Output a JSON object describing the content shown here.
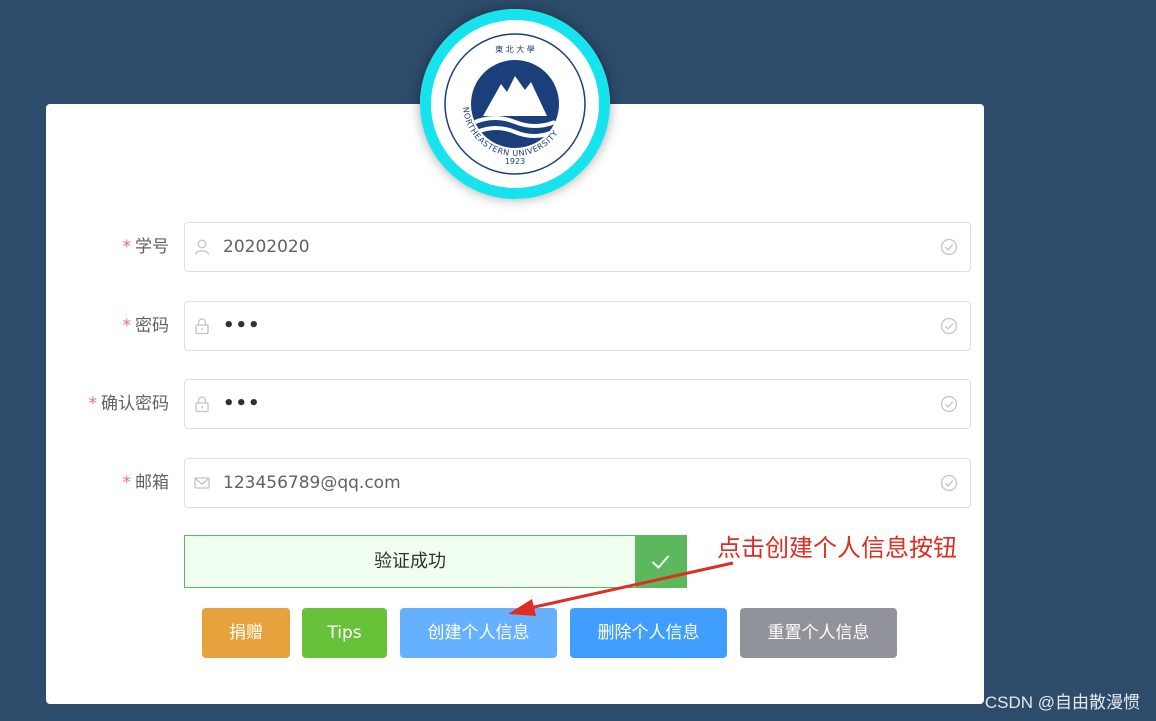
{
  "logo": {
    "arc_text": "NORTHEASTERN UNIVERSITY",
    "year": "1923",
    "top_text": "東 北 大 學"
  },
  "form": {
    "fields": [
      {
        "required_mark": "*",
        "label": "学号",
        "value": "20202020",
        "prefix_icon": "user-icon",
        "suffix_icon": "check-circle-icon"
      },
      {
        "required_mark": "*",
        "label": "密码",
        "value": "•••",
        "prefix_icon": "lock-icon",
        "suffix_icon": "check-circle-icon"
      },
      {
        "required_mark": "*",
        "label": "确认密码",
        "value": "•••",
        "prefix_icon": "lock-icon",
        "suffix_icon": "check-circle-icon"
      },
      {
        "required_mark": "*",
        "label": "邮箱",
        "value": "123456789@qq.com",
        "prefix_icon": "mail-icon",
        "suffix_icon": "check-circle-icon"
      }
    ],
    "verify": {
      "text": "验证成功",
      "icon": "check-icon",
      "color": "#5cb85c"
    }
  },
  "buttons": {
    "donate": {
      "label": "捐赠",
      "color": "#e6a23c"
    },
    "tips": {
      "label": "Tips",
      "color": "#67c23a"
    },
    "create": {
      "label": "创建个人信息",
      "color": "#66b1ff"
    },
    "delete": {
      "label": "删除个人信息",
      "color": "#409eff"
    },
    "reset": {
      "label": "重置个人信息",
      "color": "#909399"
    }
  },
  "annotation": {
    "text": "点击创建个人信息按钮",
    "color": "#e02c22"
  },
  "watermark": "CSDN @自由散漫惯"
}
